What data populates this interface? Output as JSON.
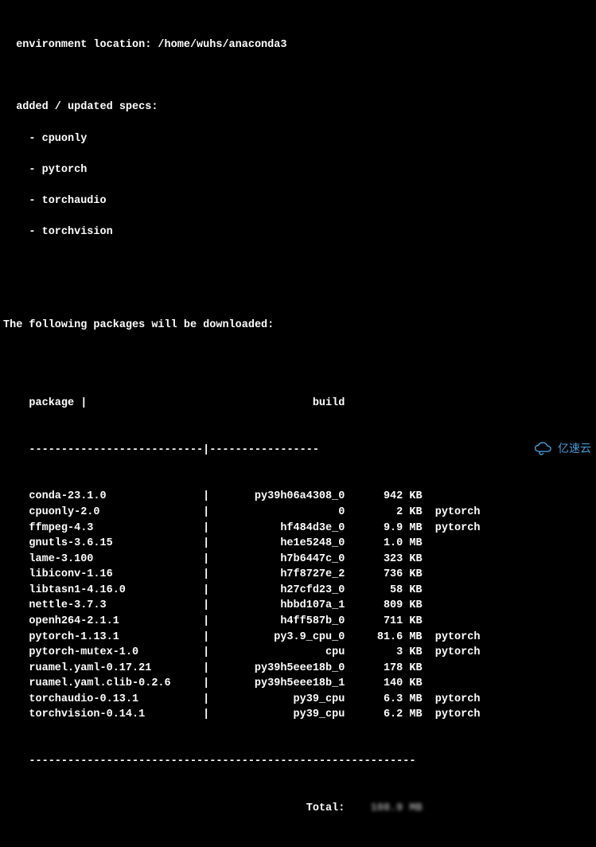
{
  "env_line": "  environment location: /home/wuhs/anaconda3",
  "specs_header": "  added / updated specs:",
  "specs": [
    "cpuonly",
    "pytorch",
    "torchaudio",
    "torchvision"
  ],
  "download_header": "The following packages will be downloaded:",
  "table_header": {
    "package": "package",
    "build": "build"
  },
  "divider_pkg": "---------------------------|-----------------",
  "packages": [
    {
      "name": "conda-23.1.0",
      "sep": "|",
      "build": "py39h06a4308_0",
      "size": "942 KB",
      "channel": ""
    },
    {
      "name": "cpuonly-2.0",
      "sep": "|",
      "build": "0",
      "size": "2 KB",
      "channel": "pytorch"
    },
    {
      "name": "ffmpeg-4.3",
      "sep": "|",
      "build": "hf484d3e_0",
      "size": "9.9 MB",
      "channel": "pytorch"
    },
    {
      "name": "gnutls-3.6.15",
      "sep": "|",
      "build": "he1e5248_0",
      "size": "1.0 MB",
      "channel": ""
    },
    {
      "name": "lame-3.100",
      "sep": "|",
      "build": "h7b6447c_0",
      "size": "323 KB",
      "channel": ""
    },
    {
      "name": "libiconv-1.16",
      "sep": "|",
      "build": "h7f8727e_2",
      "size": "736 KB",
      "channel": ""
    },
    {
      "name": "libtasn1-4.16.0",
      "sep": "|",
      "build": "h27cfd23_0",
      "size": "58 KB",
      "channel": ""
    },
    {
      "name": "nettle-3.7.3",
      "sep": "|",
      "build": "hbbd107a_1",
      "size": "809 KB",
      "channel": ""
    },
    {
      "name": "openh264-2.1.1",
      "sep": "|",
      "build": "h4ff587b_0",
      "size": "711 KB",
      "channel": ""
    },
    {
      "name": "pytorch-1.13.1",
      "sep": "|",
      "build": "py3.9_cpu_0",
      "size": "81.6 MB",
      "channel": "pytorch"
    },
    {
      "name": "pytorch-mutex-1.0",
      "sep": "|",
      "build": "cpu",
      "size": "3 KB",
      "channel": "pytorch"
    },
    {
      "name": "ruamel.yaml-0.17.21",
      "sep": "|",
      "build": "py39h5eee18b_0",
      "size": "178 KB",
      "channel": ""
    },
    {
      "name": "ruamel.yaml.clib-0.2.6",
      "sep": "|",
      "build": "py39h5eee18b_1",
      "size": "140 KB",
      "channel": ""
    },
    {
      "name": "torchaudio-0.13.1",
      "sep": "|",
      "build": "py39_cpu",
      "size": "6.3 MB",
      "channel": "pytorch"
    },
    {
      "name": "torchvision-0.14.1",
      "sep": "|",
      "build": "py39_cpu",
      "size": "6.2 MB",
      "channel": "pytorch"
    }
  ],
  "total_divider": "------------------------------------------------------------",
  "total_label": "Total:",
  "total_value": "108.9 MB",
  "watermark": "亿速云"
}
